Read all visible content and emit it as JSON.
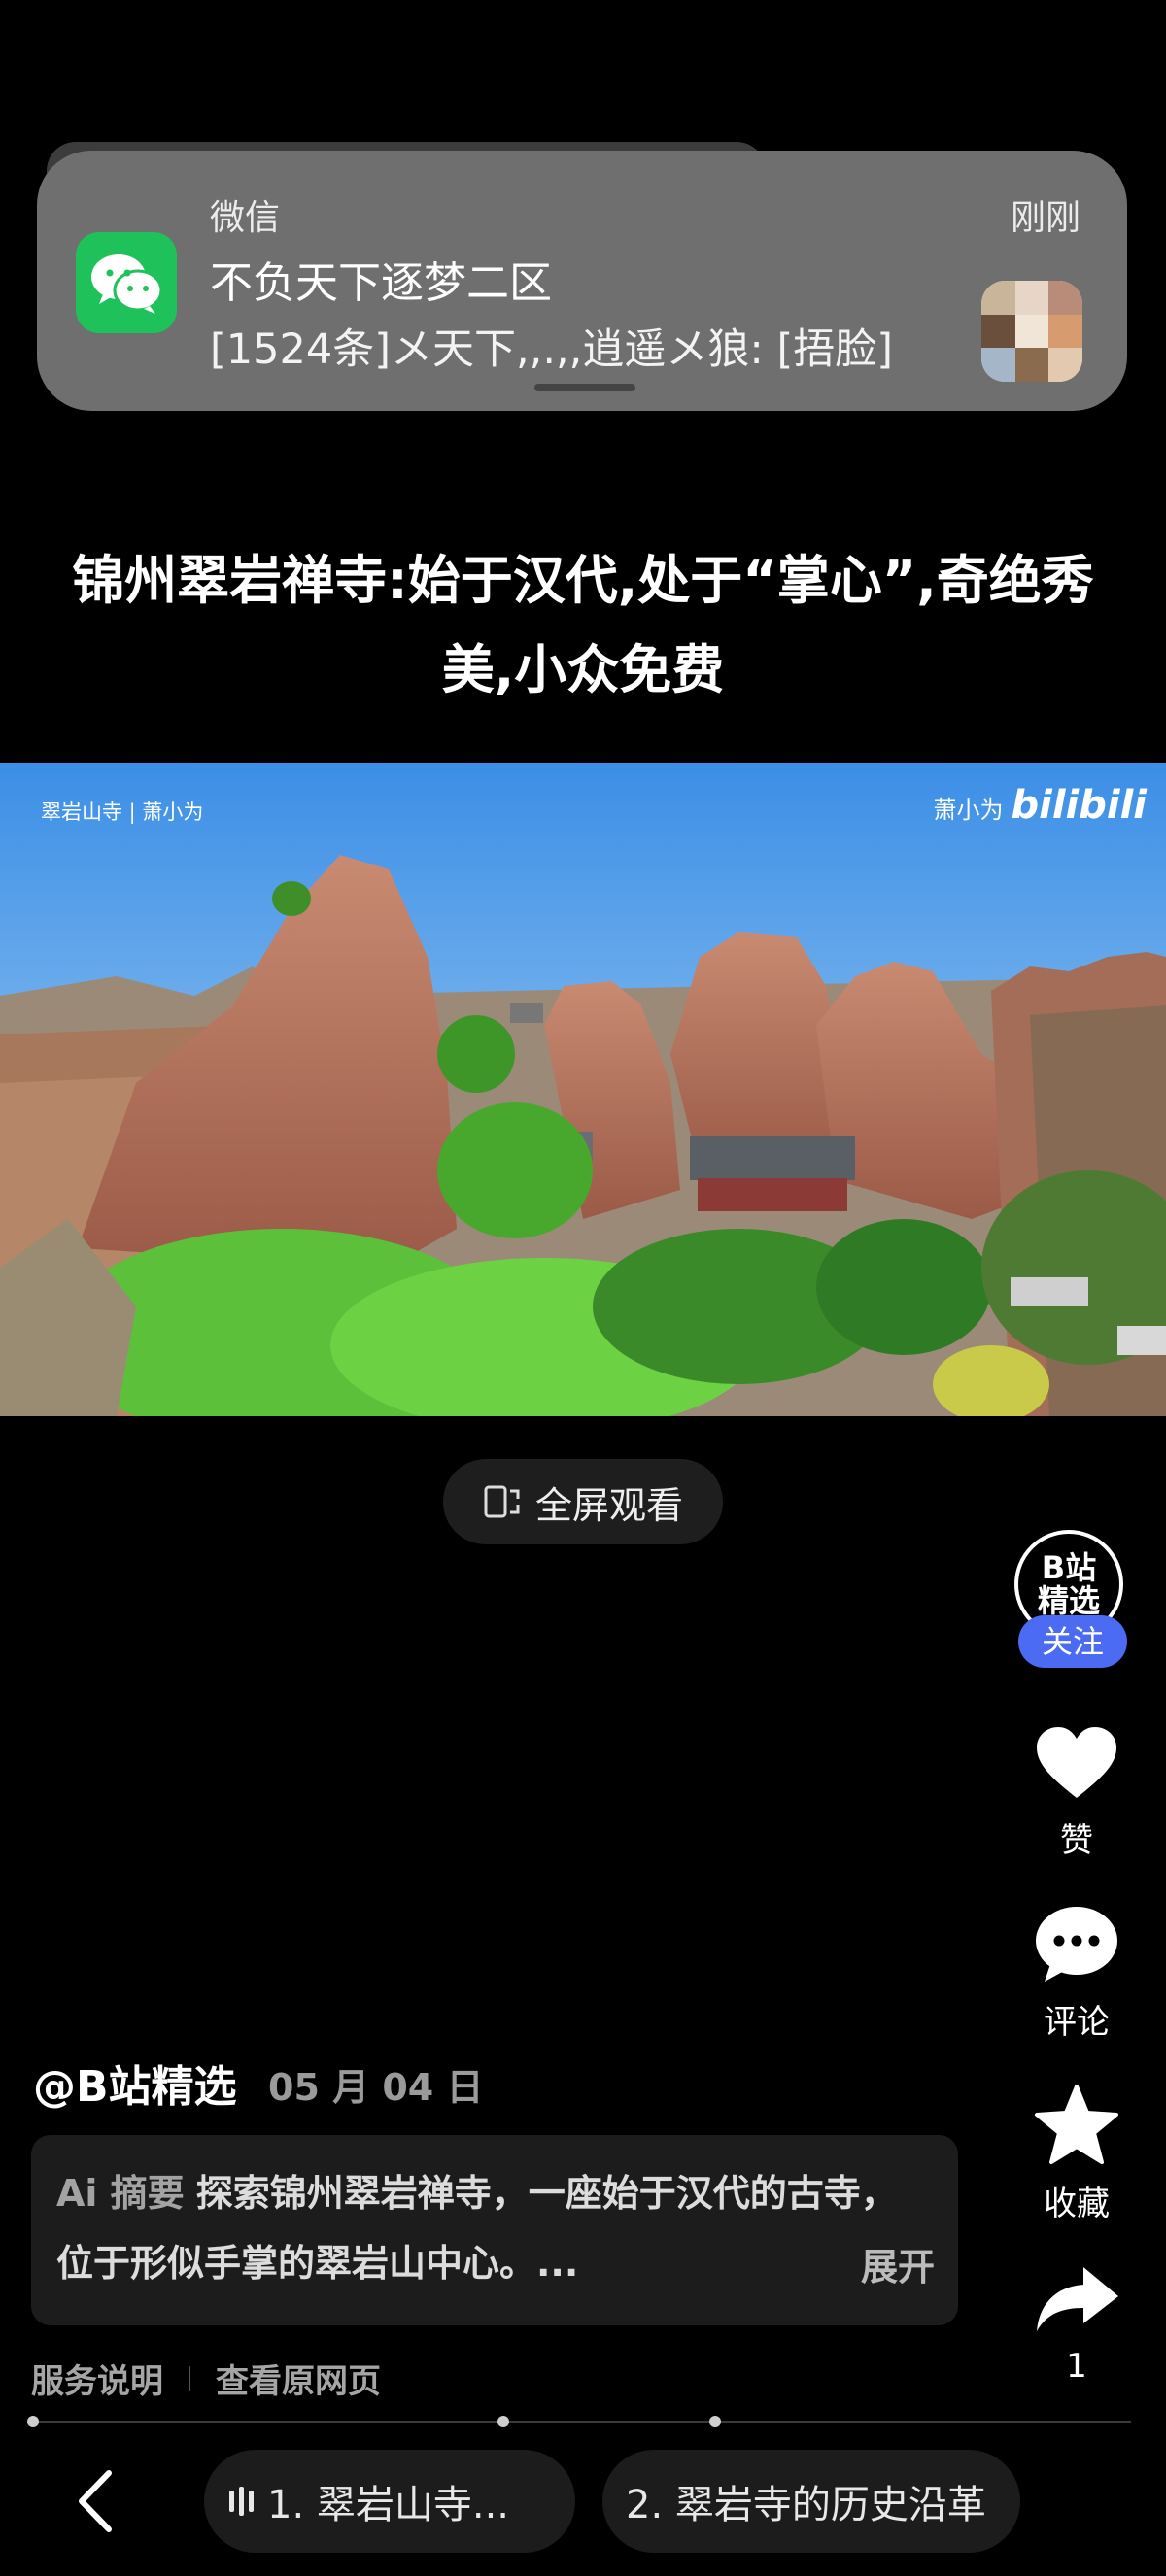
{
  "notification": {
    "app_name": "微信",
    "time": "刚刚",
    "title": "不负天下逐梦二区",
    "message": "[1524条]メ天下,,.,,逍遥メ狼: [捂脸]"
  },
  "article": {
    "title": "锦州翠岩禅寺:始于汉代,处于“掌心”,奇绝秀美,小众免费"
  },
  "video": {
    "watermark_left": "翠岩山寺 | 萧小为",
    "watermark_author": "萧小为",
    "watermark_brand": "bilibili",
    "fullscreen_label": "全屏观看"
  },
  "rail": {
    "account_badge": "B站\n精选",
    "account_badge_line1": "B站",
    "account_badge_line2": "精选",
    "follow_label": "关注",
    "like_label": "赞",
    "comment_label": "评论",
    "favorite_label": "收藏",
    "share_count": "1"
  },
  "post": {
    "author": "@B站精选",
    "date": "05 月 04 日",
    "summary_tag": "Ai 摘要",
    "summary_text": "探索锦州翠岩禅寺，一座始于汉代的古寺，位于形似手掌的翠岩山中心。...",
    "expand_label": "展开"
  },
  "links": {
    "service": "服务说明",
    "source": "查看原网页"
  },
  "chapters": [
    {
      "label": "1. 翠岩山寺..."
    },
    {
      "label": "2. 翠岩寺的历史沿革"
    }
  ],
  "colors": {
    "wechat_green": "#1fc25a",
    "follow_blue": "#4a6bf2",
    "background": "#000000"
  },
  "icons": [
    "wechat-icon",
    "fullscreen-icon",
    "heart-icon",
    "comment-icon",
    "star-icon",
    "share-icon",
    "back-arrow-icon",
    "audio-bars-icon"
  ]
}
